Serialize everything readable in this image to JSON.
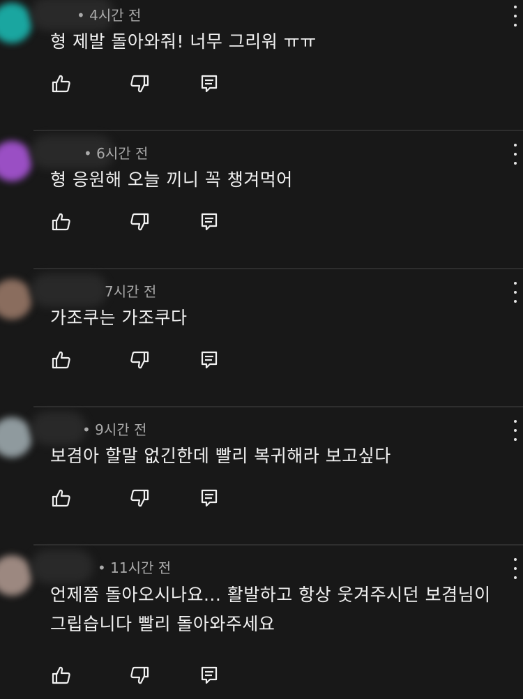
{
  "colors": {
    "background": "#181818",
    "text": "#f1f1f1",
    "meta": "#aaaaaa"
  },
  "icons": {
    "like": "thumb-up-icon",
    "dislike": "thumb-down-icon",
    "reply": "reply-icon",
    "more": "more-vertical-icon"
  },
  "comments": [
    {
      "meta": "• 4시간 전",
      "text": "형 제발 돌아와줘! 너무 그리워 ㅠㅠ",
      "avatar_color": "#1aa6a0"
    },
    {
      "meta": "• 6시간 전",
      "text": "형 응원해 오늘 끼니 꼭 챙겨먹어",
      "avatar_color": "#9a4fc4"
    },
    {
      "meta": "7시간 전",
      "text": "가조쿠는 가조쿠다",
      "avatar_color": "#8a6d5e"
    },
    {
      "meta": "• 9시간 전",
      "text": "보겸아 할말 없긴한데 빨리 복귀해라 보고싶다",
      "avatar_color": "#8f9a9e"
    },
    {
      "meta": "• 11시간 전",
      "text": "언제쯤 돌아오시나요... 활발하고 항상 웃겨주시던 보겸님이 그립습니다 빨리 돌아와주세요",
      "avatar_color": "#9c8880"
    }
  ]
}
